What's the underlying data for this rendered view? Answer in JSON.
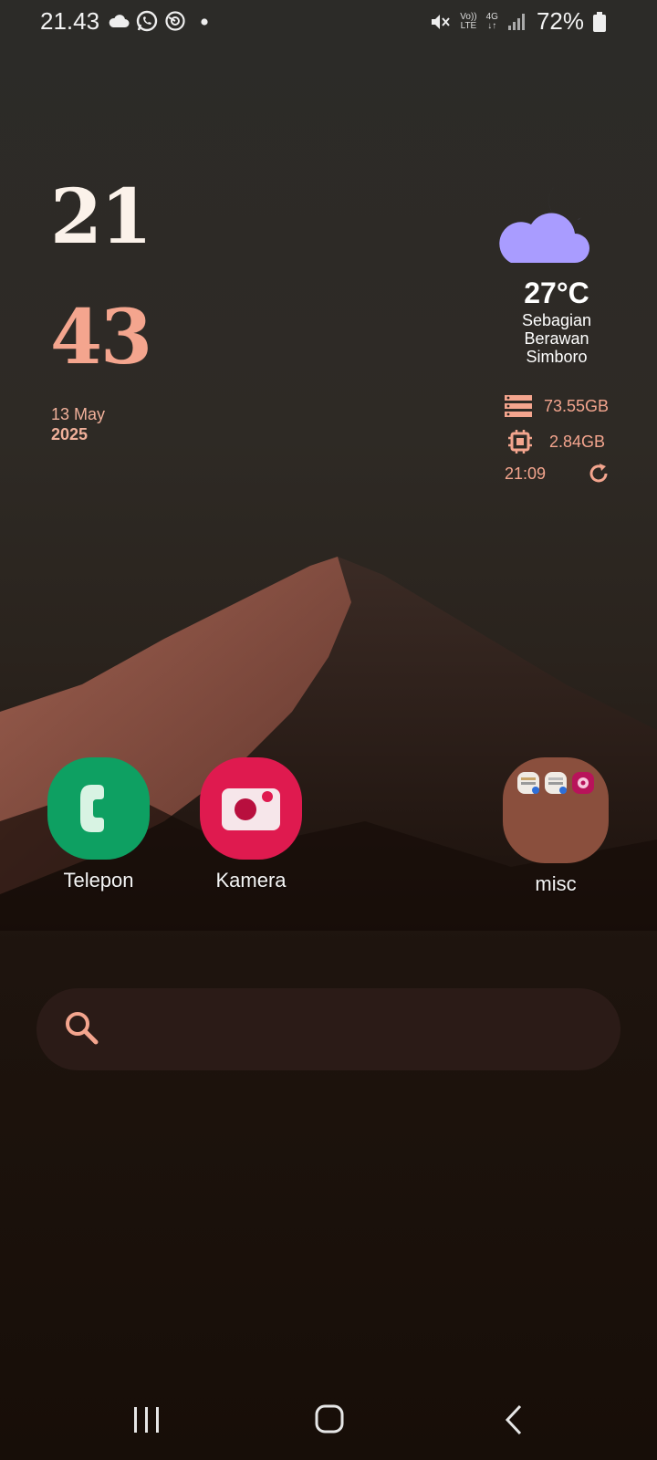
{
  "status_bar": {
    "time": "21.43",
    "network_top": "Vo))",
    "network_bottom": "LTE",
    "data_type": "4G",
    "battery": "72%"
  },
  "clock": {
    "hour": "21",
    "minute": "43",
    "date_line1": "13 May",
    "date_line2": "2025"
  },
  "weather": {
    "temperature": "27°C",
    "condition_line1": "Sebagian",
    "condition_line2": "Berawan",
    "location": "Simboro",
    "icon_color": "#a99cff"
  },
  "system": {
    "storage": "73.55GB",
    "memory": "2.84GB",
    "updated": "21:09"
  },
  "apps": [
    {
      "label": "Telepon",
      "icon": "phone-icon",
      "color": "#0ea062"
    },
    {
      "label": "Kamera",
      "icon": "camera-icon",
      "color": "#df1a4f"
    },
    {
      "label": "misc",
      "icon": "folder-icon",
      "color": "#8a4f3d"
    }
  ],
  "search": {
    "placeholder": ""
  },
  "colors": {
    "accent": "#f4a58e"
  }
}
